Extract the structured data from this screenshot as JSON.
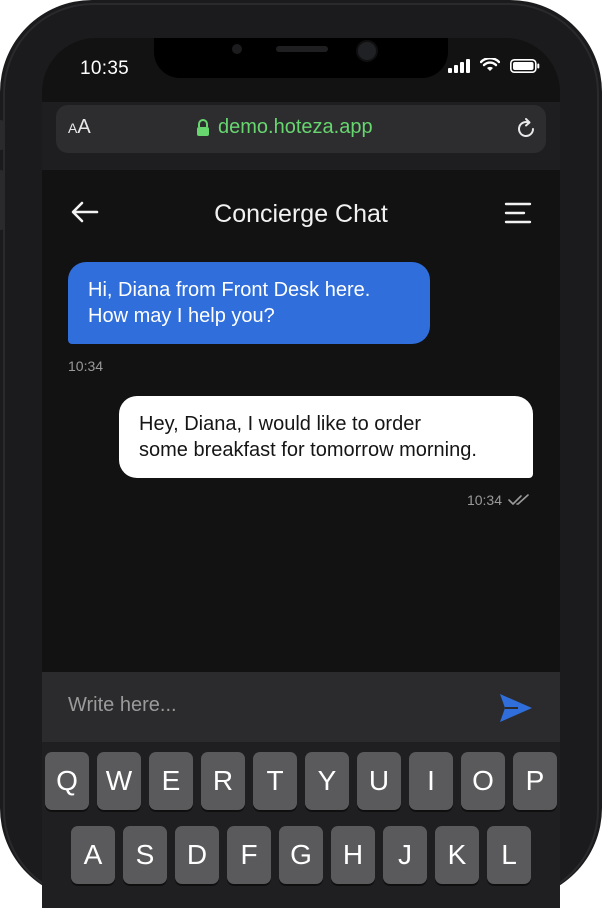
{
  "status_bar": {
    "time": "10:35"
  },
  "browser": {
    "text_size_label_small": "A",
    "text_size_label_large": "A",
    "url": "demo.hoteza.app"
  },
  "header": {
    "title": "Concierge Chat"
  },
  "messages": [
    {
      "sender": "concierge",
      "line1": "Hi, Diana from Front Desk here.",
      "line2": "How may I help you?",
      "time": "10:34"
    },
    {
      "sender": "guest",
      "line1": "Hey, Diana, I would like to order",
      "line2": "some breakfast for tomorrow morning.",
      "time": "10:34"
    }
  ],
  "composer": {
    "placeholder": "Write here..."
  },
  "keyboard": {
    "row1": [
      "Q",
      "W",
      "E",
      "R",
      "T",
      "Y",
      "U",
      "I",
      "O",
      "P"
    ],
    "row2": [
      "A",
      "S",
      "D",
      "F",
      "G",
      "H",
      "J",
      "K",
      "L"
    ]
  },
  "colors": {
    "accent": "#2f6edb",
    "url_green": "#67d66f",
    "background": "#121212"
  }
}
